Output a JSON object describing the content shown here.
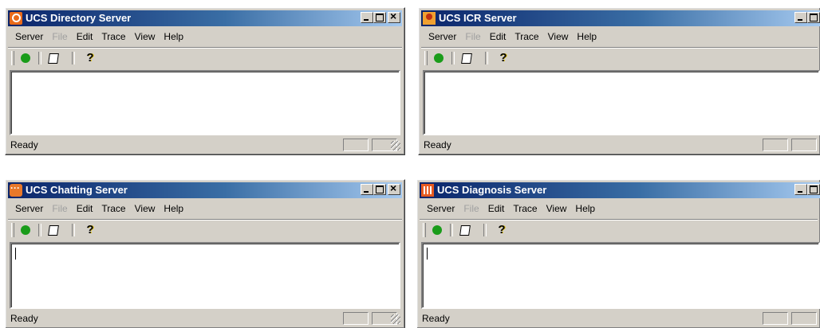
{
  "menus": {
    "server": "Server",
    "file": "File",
    "edit": "Edit",
    "trace": "Trace",
    "view": "View",
    "help": "Help"
  },
  "windows": [
    {
      "title": "UCS Directory Server",
      "icon": "directory-icon",
      "status": "Ready"
    },
    {
      "title": "UCS ICR Server",
      "icon": "icr-icon",
      "status": "Ready"
    },
    {
      "title": "UCS Chatting Server",
      "icon": "chat-icon",
      "status": "Ready"
    },
    {
      "title": "UCS Diagnosis Server",
      "icon": "diagnosis-icon",
      "status": "Ready"
    }
  ],
  "toolbar": {
    "help_glyph": "?"
  },
  "colors": {
    "title_active_start": "#0a246a",
    "title_active_end": "#a6caf0",
    "start_icon": "#1a9c1a"
  }
}
